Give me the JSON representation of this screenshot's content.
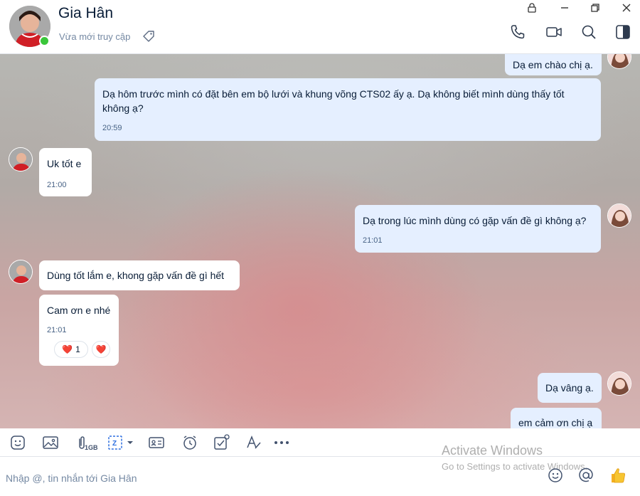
{
  "header": {
    "contact_name": "Gia Hân",
    "status": "Vừa mới truy cập",
    "tag_icon": "tag-icon",
    "window_icons": [
      "lock-icon",
      "minimize-icon",
      "restore-icon",
      "close-icon"
    ],
    "action_icons": [
      "phone-icon",
      "video-call-icon",
      "search-icon",
      "sidebar-toggle-icon"
    ]
  },
  "messages": [
    {
      "side": "me",
      "text": "Dạ em chào chị ạ.",
      "time": ""
    },
    {
      "side": "me",
      "text": "Dạ hôm trước mình có đặt bên em bộ lưới và khung võng CTS02 ấy ạ. Dạ không biết mình dùng thấy tốt không ạ?",
      "time": "20:59"
    },
    {
      "side": "them",
      "text": "Uk tốt e",
      "time": "21:00"
    },
    {
      "side": "me",
      "text": "Dạ trong lúc mình dùng có gặp vấn đề gì không ạ?",
      "time": "21:01"
    },
    {
      "side": "them",
      "text": "Dùng tốt lắm e, khong gặp vấn đề gì hết",
      "time": ""
    },
    {
      "side": "them",
      "text": "Cam ơn e nhé",
      "time": "21:01",
      "reaction": {
        "emoji": "❤️",
        "count": "1",
        "react_button": "❤️"
      }
    },
    {
      "side": "me",
      "text": "Dạ vâng ạ.",
      "time": ""
    },
    {
      "side": "me",
      "text": "em cảm ơn chị ạ",
      "time": ""
    }
  ],
  "toolbar": {
    "icons": [
      "sticker-icon",
      "image-icon",
      "attachment-icon",
      "screenshot-icon",
      "contact-card-icon",
      "reminder-clock-icon",
      "task-check-icon",
      "format-text-icon",
      "more-icon"
    ],
    "attachment_limit": "1GB"
  },
  "input": {
    "placeholder": "Nhập @, tin nhắn tới Gia Hân",
    "value": "",
    "icons": [
      "emoji-icon",
      "mention-icon",
      "thumbs-up-icon"
    ]
  },
  "watermark": {
    "line1": "Activate Windows",
    "line2": "Go to Settings to activate Windows."
  },
  "colors": {
    "my_bubble": "#e5efff",
    "their_bubble": "#ffffff",
    "online": "#3ac63a",
    "time_text": "#476285"
  }
}
